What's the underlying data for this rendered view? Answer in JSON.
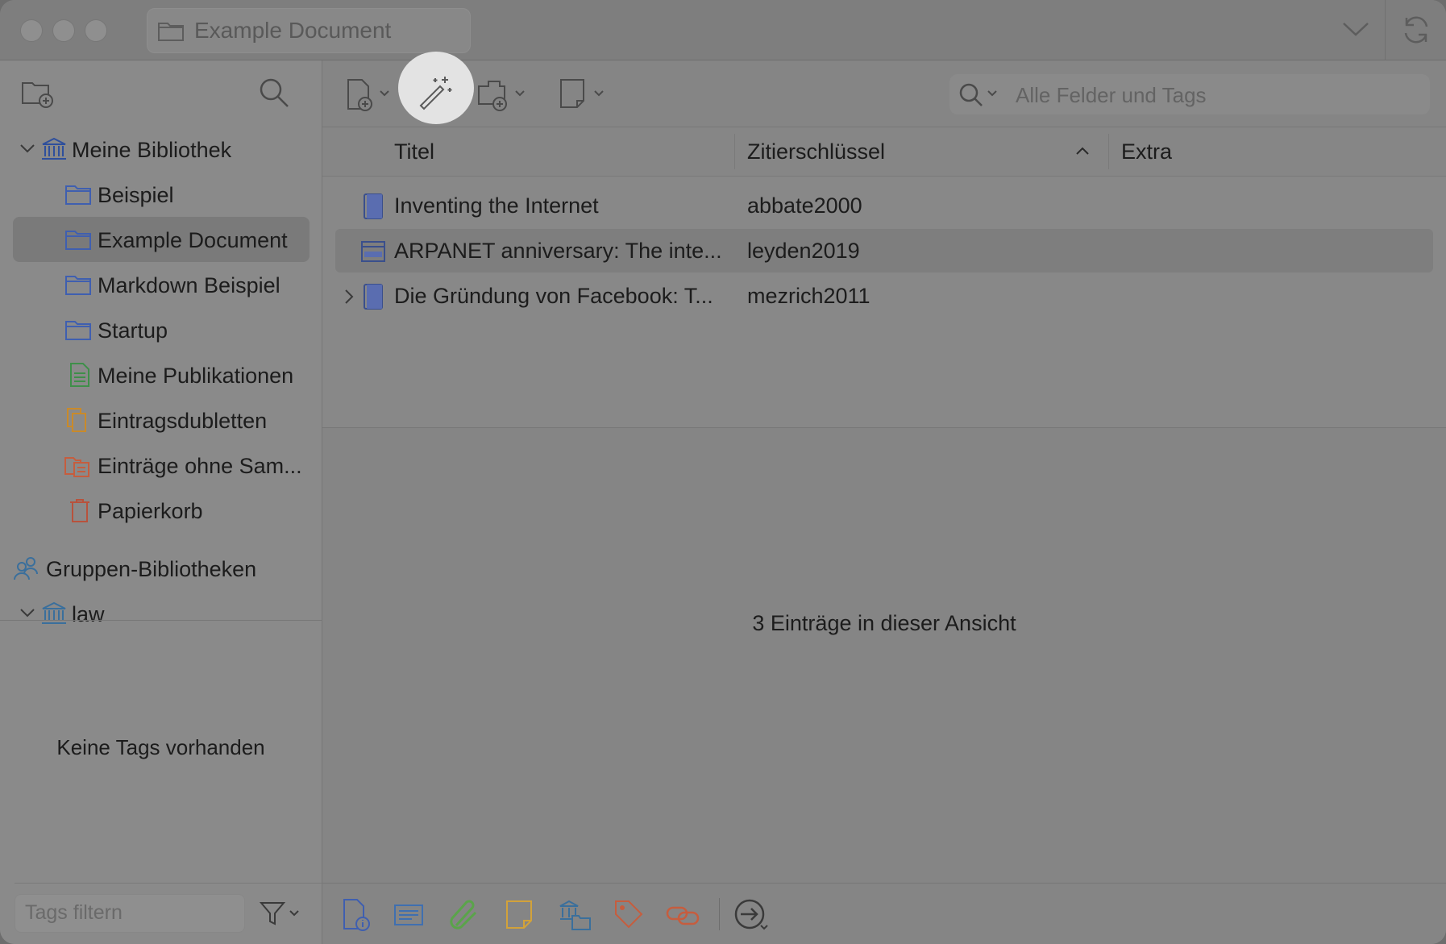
{
  "window": {
    "title": "Example Document"
  },
  "sidebar": {
    "items": [
      {
        "label": "Meine Bibliothek"
      },
      {
        "label": "Beispiel"
      },
      {
        "label": "Example Document"
      },
      {
        "label": "Markdown Beispiel"
      },
      {
        "label": "Startup"
      },
      {
        "label": "Meine Publikationen"
      },
      {
        "label": "Eintragsdubletten"
      },
      {
        "label": "Einträge ohne Sam..."
      },
      {
        "label": "Papierkorb"
      },
      {
        "label": "Gruppen-Bibliotheken"
      },
      {
        "label": "law"
      }
    ],
    "no_tags": "Keine Tags vorhanden",
    "tag_filter_placeholder": "Tags filtern"
  },
  "search": {
    "placeholder": "Alle Felder und Tags"
  },
  "table": {
    "columns": [
      "Titel",
      "Zitierschlüssel",
      "Extra"
    ],
    "rows": [
      {
        "title": "Inventing the Internet",
        "key": "abbate2000"
      },
      {
        "title": "ARPANET anniversary: The inte...",
        "key": "leyden2019"
      },
      {
        "title": "Die Gründung von Facebook: T...",
        "key": "mezrich2011"
      }
    ]
  },
  "status": {
    "count": "3 Einträge in dieser Ansicht"
  },
  "colors": {
    "folder_icon": "#3f5fb0",
    "library_icon": "#2e4f9c",
    "publications_icon": "#3f8f4a",
    "duplicates_icon": "#c98a2a",
    "unfiled_icon": "#c65d3e",
    "trash_icon": "#b8523c",
    "highlight": "#e3e3e3"
  }
}
